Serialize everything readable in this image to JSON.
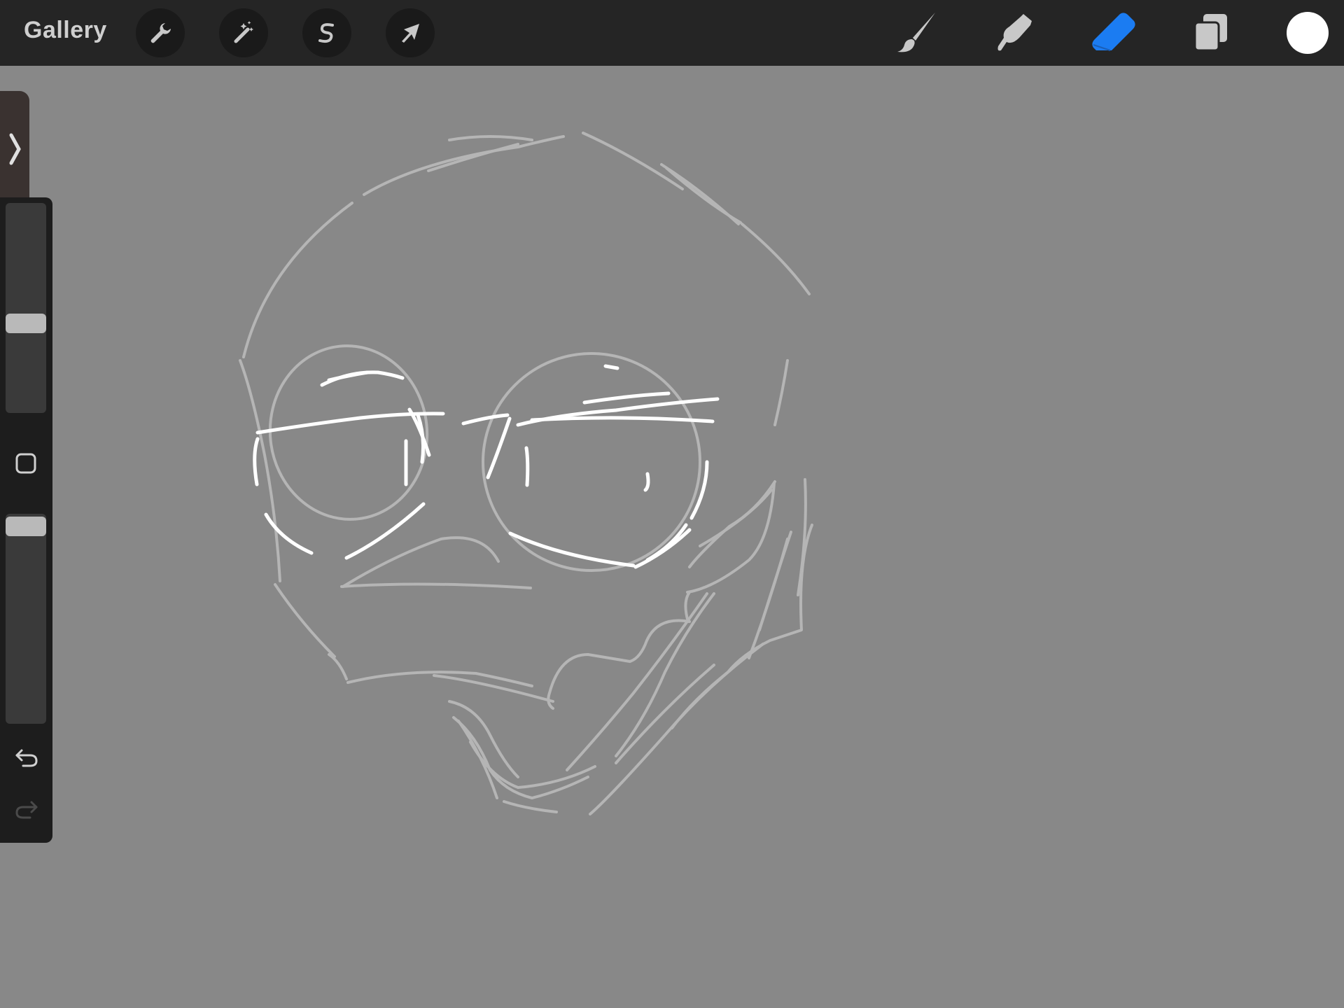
{
  "topbar": {
    "gallery_label": "Gallery",
    "left_tools": [
      {
        "name": "actions",
        "icon": "wrench-icon"
      },
      {
        "name": "adjustments",
        "icon": "magic-wand-icon"
      },
      {
        "name": "selection",
        "icon": "selection-s-icon"
      },
      {
        "name": "transform",
        "icon": "arrow-cursor-icon"
      }
    ],
    "right_tools": [
      {
        "name": "brush",
        "icon": "brush-icon",
        "active": false
      },
      {
        "name": "smudge",
        "icon": "smudge-finger-icon",
        "active": false
      },
      {
        "name": "eraser",
        "icon": "eraser-icon",
        "active": true
      },
      {
        "name": "layers",
        "icon": "layers-icon",
        "active": false
      }
    ],
    "current_color": "#ffffff",
    "active_tool_color": "#1b7cf2"
  },
  "sidebar": {
    "brush_size": 0.57,
    "brush_opacity": 0.95,
    "modify_icon": "square-icon",
    "undo_icon": "undo-arrow-icon",
    "redo_icon": "redo-arrow-icon"
  },
  "canvas": {
    "background": "#888888",
    "sketch_stroke_color": "#b5b5b5",
    "highlight_stroke_color": "#ffffff"
  }
}
